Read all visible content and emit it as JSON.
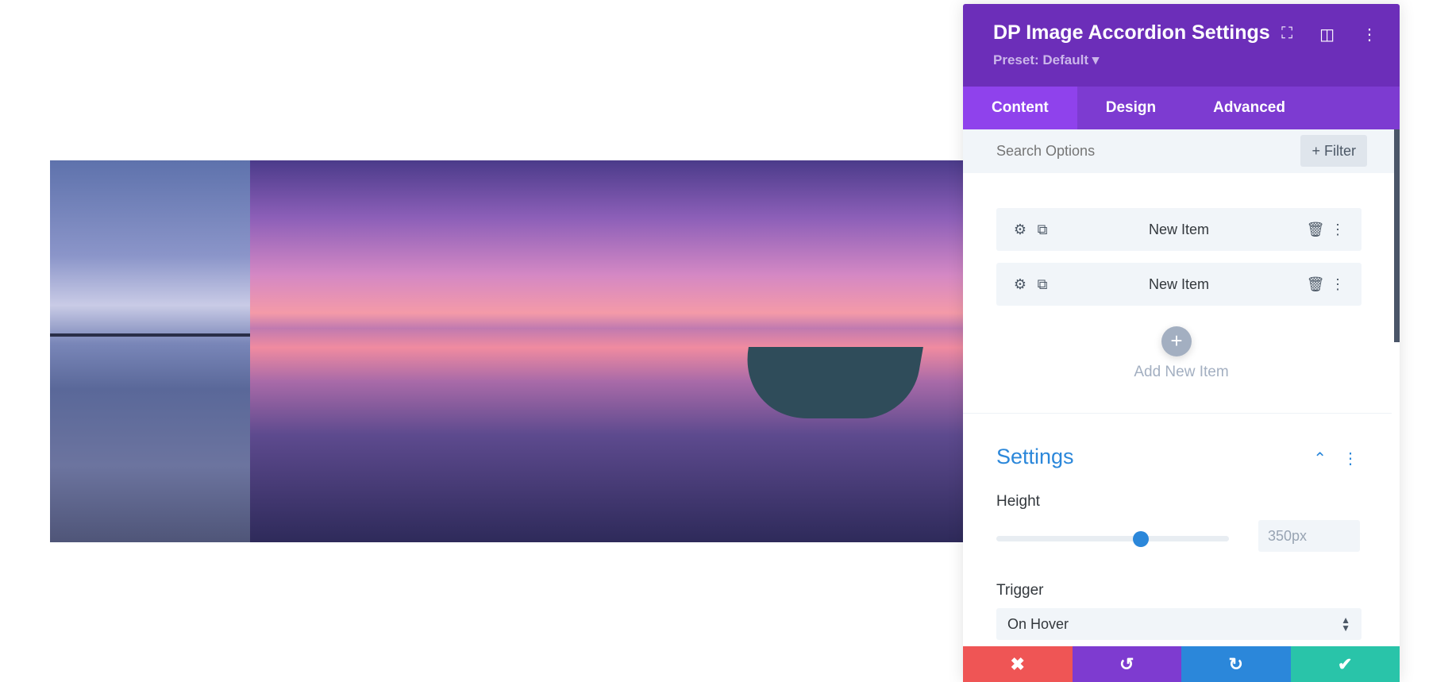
{
  "panel": {
    "title": "DP Image Accordion Settings",
    "preset": "Preset: Default ▾",
    "tabs": [
      {
        "label": "Content"
      },
      {
        "label": "Design"
      },
      {
        "label": "Advanced"
      }
    ],
    "search_placeholder": "Search Options",
    "filter_label": "+ Filter",
    "items": [
      {
        "label": "New Item"
      },
      {
        "label": "New Item"
      }
    ],
    "add_item_label": "Add New Item",
    "section_title": "Settings",
    "height_label": "Height",
    "height_value": "350px",
    "height_slider_fraction": 0.62,
    "trigger_label": "Trigger",
    "trigger_value": "On Hover",
    "colors": {
      "header": "#6c2eb9",
      "tabs": "#7d3bd1",
      "accent": "#2b87da",
      "cancel": "#ef5555",
      "undo": "#7e3bd0",
      "redo": "#2b87da",
      "save": "#29c4a9"
    }
  }
}
